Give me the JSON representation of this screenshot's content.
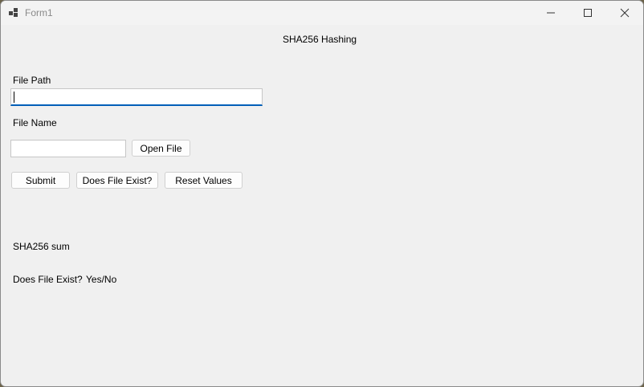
{
  "window": {
    "title": "Form1",
    "icons": {
      "app": "app-icon",
      "minimize": "minimize-icon",
      "maximize": "maximize-icon",
      "close": "close-icon"
    }
  },
  "form": {
    "header": "SHA256 Hashing",
    "file_path_label": "File Path",
    "file_path_value": "",
    "file_name_label": "File Name",
    "file_name_value": "",
    "open_file_button": "Open File",
    "submit_button": "Submit",
    "file_exist_button": "Does File Exist?",
    "reset_button": "Reset Values",
    "sha_label": "SHA256 sum",
    "exist_label": "Does File Exist?",
    "exist_value": "Yes/No"
  },
  "colors": {
    "focus_accent": "#005fb8",
    "window_bg": "#f0f0f0"
  }
}
